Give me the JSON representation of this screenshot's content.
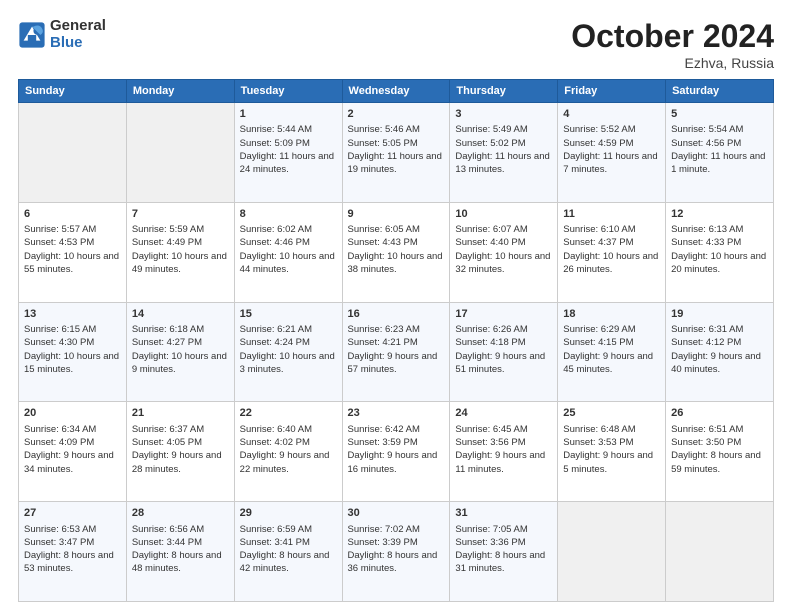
{
  "logo": {
    "general": "General",
    "blue": "Blue"
  },
  "header": {
    "title": "October 2024",
    "subtitle": "Ezhva, Russia"
  },
  "calendar": {
    "days_of_week": [
      "Sunday",
      "Monday",
      "Tuesday",
      "Wednesday",
      "Thursday",
      "Friday",
      "Saturday"
    ],
    "weeks": [
      [
        {
          "day": "",
          "empty": true
        },
        {
          "day": "",
          "empty": true
        },
        {
          "day": "1",
          "sunrise": "5:44 AM",
          "sunset": "5:09 PM",
          "daylight": "11 hours and 24 minutes."
        },
        {
          "day": "2",
          "sunrise": "5:46 AM",
          "sunset": "5:05 PM",
          "daylight": "11 hours and 19 minutes."
        },
        {
          "day": "3",
          "sunrise": "5:49 AM",
          "sunset": "5:02 PM",
          "daylight": "11 hours and 13 minutes."
        },
        {
          "day": "4",
          "sunrise": "5:52 AM",
          "sunset": "4:59 PM",
          "daylight": "11 hours and 7 minutes."
        },
        {
          "day": "5",
          "sunrise": "5:54 AM",
          "sunset": "4:56 PM",
          "daylight": "11 hours and 1 minute."
        }
      ],
      [
        {
          "day": "6",
          "sunrise": "5:57 AM",
          "sunset": "4:53 PM",
          "daylight": "10 hours and 55 minutes."
        },
        {
          "day": "7",
          "sunrise": "5:59 AM",
          "sunset": "4:49 PM",
          "daylight": "10 hours and 49 minutes."
        },
        {
          "day": "8",
          "sunrise": "6:02 AM",
          "sunset": "4:46 PM",
          "daylight": "10 hours and 44 minutes."
        },
        {
          "day": "9",
          "sunrise": "6:05 AM",
          "sunset": "4:43 PM",
          "daylight": "10 hours and 38 minutes."
        },
        {
          "day": "10",
          "sunrise": "6:07 AM",
          "sunset": "4:40 PM",
          "daylight": "10 hours and 32 minutes."
        },
        {
          "day": "11",
          "sunrise": "6:10 AM",
          "sunset": "4:37 PM",
          "daylight": "10 hours and 26 minutes."
        },
        {
          "day": "12",
          "sunrise": "6:13 AM",
          "sunset": "4:33 PM",
          "daylight": "10 hours and 20 minutes."
        }
      ],
      [
        {
          "day": "13",
          "sunrise": "6:15 AM",
          "sunset": "4:30 PM",
          "daylight": "10 hours and 15 minutes."
        },
        {
          "day": "14",
          "sunrise": "6:18 AM",
          "sunset": "4:27 PM",
          "daylight": "10 hours and 9 minutes."
        },
        {
          "day": "15",
          "sunrise": "6:21 AM",
          "sunset": "4:24 PM",
          "daylight": "10 hours and 3 minutes."
        },
        {
          "day": "16",
          "sunrise": "6:23 AM",
          "sunset": "4:21 PM",
          "daylight": "9 hours and 57 minutes."
        },
        {
          "day": "17",
          "sunrise": "6:26 AM",
          "sunset": "4:18 PM",
          "daylight": "9 hours and 51 minutes."
        },
        {
          "day": "18",
          "sunrise": "6:29 AM",
          "sunset": "4:15 PM",
          "daylight": "9 hours and 45 minutes."
        },
        {
          "day": "19",
          "sunrise": "6:31 AM",
          "sunset": "4:12 PM",
          "daylight": "9 hours and 40 minutes."
        }
      ],
      [
        {
          "day": "20",
          "sunrise": "6:34 AM",
          "sunset": "4:09 PM",
          "daylight": "9 hours and 34 minutes."
        },
        {
          "day": "21",
          "sunrise": "6:37 AM",
          "sunset": "4:05 PM",
          "daylight": "9 hours and 28 minutes."
        },
        {
          "day": "22",
          "sunrise": "6:40 AM",
          "sunset": "4:02 PM",
          "daylight": "9 hours and 22 minutes."
        },
        {
          "day": "23",
          "sunrise": "6:42 AM",
          "sunset": "3:59 PM",
          "daylight": "9 hours and 16 minutes."
        },
        {
          "day": "24",
          "sunrise": "6:45 AM",
          "sunset": "3:56 PM",
          "daylight": "9 hours and 11 minutes."
        },
        {
          "day": "25",
          "sunrise": "6:48 AM",
          "sunset": "3:53 PM",
          "daylight": "9 hours and 5 minutes."
        },
        {
          "day": "26",
          "sunrise": "6:51 AM",
          "sunset": "3:50 PM",
          "daylight": "8 hours and 59 minutes."
        }
      ],
      [
        {
          "day": "27",
          "sunrise": "6:53 AM",
          "sunset": "3:47 PM",
          "daylight": "8 hours and 53 minutes."
        },
        {
          "day": "28",
          "sunrise": "6:56 AM",
          "sunset": "3:44 PM",
          "daylight": "8 hours and 48 minutes."
        },
        {
          "day": "29",
          "sunrise": "6:59 AM",
          "sunset": "3:41 PM",
          "daylight": "8 hours and 42 minutes."
        },
        {
          "day": "30",
          "sunrise": "7:02 AM",
          "sunset": "3:39 PM",
          "daylight": "8 hours and 36 minutes."
        },
        {
          "day": "31",
          "sunrise": "7:05 AM",
          "sunset": "3:36 PM",
          "daylight": "8 hours and 31 minutes."
        },
        {
          "day": "",
          "empty": true
        },
        {
          "day": "",
          "empty": true
        }
      ]
    ]
  }
}
